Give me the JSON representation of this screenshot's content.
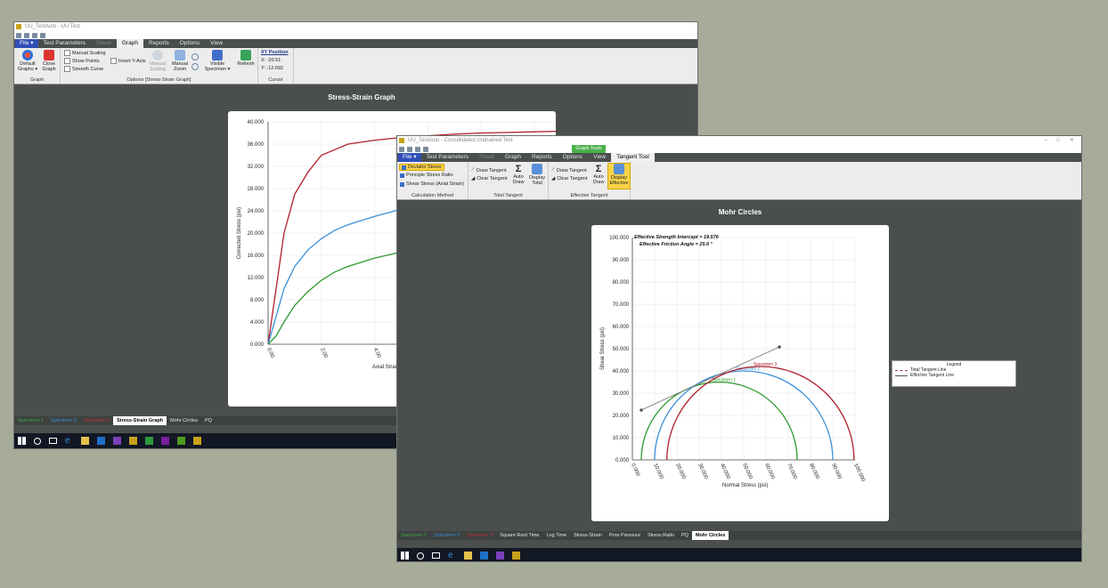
{
  "win1": {
    "title": "UU_TestAuto - UU Test",
    "menu": [
      "Test Parameters",
      "Sheet",
      "Graph",
      "Reports",
      "Options",
      "View"
    ],
    "file_label": "File ▾",
    "ribbon": {
      "default_graphs": "Default Graphs ▾",
      "close_graph": "Close Graph",
      "group_graph": "Graph",
      "manual_scaling_chk": "Manual Scaling",
      "show_points_chk": "Show Points",
      "smooth_curve_chk": "Smooth Curve",
      "invert_y_chk": "Invert Y-Axis",
      "manual_scaling_btn": "Manual Scaling",
      "manual_zoom": "Manual Zoom",
      "visible_specimen": "Visible Specimen ▾",
      "refresh": "Refresh",
      "group_options": "Options [Stress-Strain Graph]",
      "xy_position": "XY Position",
      "x_val": "X: -20.51",
      "y_val": "Y: -12.692",
      "group_cursor": "Cursor"
    },
    "chart_title": "Stress-Strain Graph",
    "tabs": [
      "Specimen 1",
      "Specimen 2",
      "Specimen 3",
      "Stress-Strain Graph",
      "Mohr Circles",
      "PQ"
    ],
    "tab_colors": [
      "#3fa33f",
      "#3b8fd9",
      "#c0303a",
      "",
      "",
      ""
    ]
  },
  "win2": {
    "title": "UU_TestAuto - Consolidated Undrained Test",
    "graph_tools": "Graph Tools",
    "menu": [
      "Test Parameters",
      "Sheet",
      "Graph",
      "Reports",
      "Options",
      "View",
      "Tangent Tool"
    ],
    "file_label": "File ▾",
    "ribbon": {
      "deviator": "Deviator Stress",
      "principal": "Principle Stress Ratio",
      "shear": "Shear Stress (Axial Strain)",
      "group_calc": "Calculation Method",
      "draw_tangent": "Draw Tangent",
      "clear_tangent": "Clear Tangent",
      "auto_draw": "Auto Draw",
      "display_total": "Display Total",
      "group_total": "Total Tangent",
      "draw_tangent2": "Draw Tangent",
      "clear_tangent2": "Clear Tangent",
      "auto_draw2": "Auto Draw",
      "display_effective": "Display Effective",
      "group_effective": "Effective Tangent"
    },
    "chart_title": "Mohr Circles",
    "tabs": [
      "Specimen 1",
      "Specimen 2",
      "Specimen 3",
      "Square Root Time",
      "Log Time",
      "Stress-Strain",
      "Pore Pressure",
      "Stress Ratio",
      "PQ",
      "Mohr Circles"
    ],
    "tab_colors": [
      "#3fa33f",
      "#3b8fd9",
      "#c0303a",
      "",
      "",
      "",
      "",
      "",
      "",
      ""
    ]
  },
  "chart_data": [
    {
      "type": "line",
      "title": "Stress-Strain Graph",
      "xlabel": "Axial Strain",
      "ylabel": "Corrected Stress (psi)",
      "ylim": [
        0,
        40
      ],
      "yticks": [
        "0.000",
        "4.000",
        "8.000",
        "12.000",
        "16.000",
        "20.000",
        "24.000",
        "28.000",
        "32.000",
        "36.000",
        "40.000"
      ],
      "xticks": [
        "0.00",
        "2.00",
        "4.00",
        "6.00",
        "8.00",
        "10.00"
      ],
      "xlim_visible": [
        0,
        10.8
      ],
      "series": [
        {
          "color": "#b0202a",
          "x": [
            0,
            0.3,
            0.6,
            1,
            1.5,
            2,
            2.5,
            3,
            4,
            5,
            6,
            7,
            8,
            9,
            10,
            10.8
          ],
          "y": [
            0,
            10,
            20,
            27,
            31,
            34,
            35,
            36,
            36.7,
            37.2,
            37.5,
            37.8,
            38,
            38.1,
            38.2,
            38.3
          ]
        },
        {
          "color": "#3a8fd8",
          "x": [
            0,
            0.3,
            0.6,
            1,
            1.5,
            2,
            2.5,
            3,
            4,
            5,
            6,
            7,
            8,
            9,
            10,
            10.8
          ],
          "y": [
            0,
            5,
            10,
            14,
            17,
            19,
            20.5,
            21.5,
            23,
            24.3,
            25.3,
            26,
            26.6,
            27,
            27.4,
            27.6
          ]
        },
        {
          "color": "#2d9a2d",
          "x": [
            0,
            0.3,
            0.6,
            1,
            1.5,
            2,
            2.5,
            3,
            4,
            5,
            6,
            7,
            8,
            9,
            10,
            10.8
          ],
          "y": [
            0,
            1.5,
            4,
            7,
            9.5,
            11.5,
            13,
            14,
            15.5,
            16.6,
            17.2,
            17.4,
            17.6,
            17.8,
            18,
            18.1
          ]
        }
      ]
    },
    {
      "type": "scatter",
      "title": "Mohr Circles",
      "xlabel": "Normal Stress (psi)",
      "ylabel": "Shear Stress (psi)",
      "xlim": [
        0,
        100
      ],
      "ylim": [
        0,
        100
      ],
      "xticks": [
        "0.000",
        "10.000",
        "20.000",
        "30.000",
        "40.000",
        "50.000",
        "60.000",
        "70.000",
        "80.000",
        "90.000",
        "100.000"
      ],
      "yticks": [
        "0.000",
        "10.000",
        "20.000",
        "30.000",
        "40.000",
        "50.000",
        "60.000",
        "70.000",
        "80.000",
        "90.000",
        "100.000"
      ],
      "annotations": [
        "Effective Strength Intercept = 19.576",
        "Effective Friction Angle = 25.6 °"
      ],
      "circles": [
        {
          "name": "Specimen 1",
          "center": 39,
          "radius": 35,
          "color": "#2d9a2d"
        },
        {
          "name": "Specimen 2",
          "center": 50,
          "radius": 40,
          "color": "#3a8fd8"
        },
        {
          "name": "Specimen 3",
          "center": 57.5,
          "radius": 42,
          "color": "#b0202a"
        }
      ],
      "tangent": {
        "x": [
          4,
          66
        ],
        "y": [
          22.4,
          50.8
        ],
        "color": "#777777"
      },
      "legend": {
        "title": "Legend",
        "items": [
          {
            "label": "Total Tangent Line",
            "color": "#b0306a"
          },
          {
            "label": "Effective Tangent Line",
            "color": "#555555"
          }
        ]
      }
    }
  ]
}
